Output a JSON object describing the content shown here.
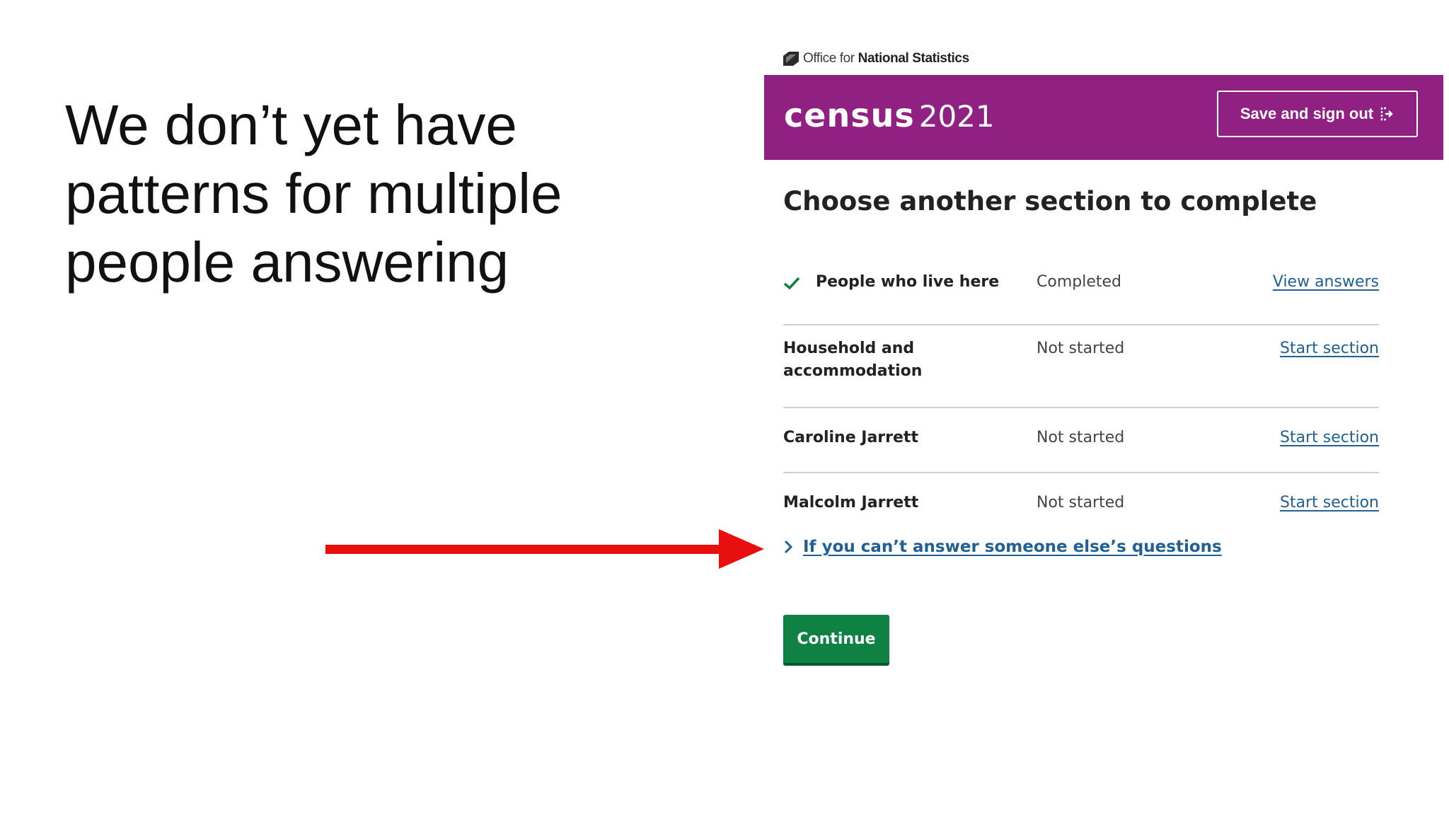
{
  "slide": {
    "lines": [
      "We don’t yet have",
      "patterns for multiple",
      "people answering"
    ]
  },
  "ons": {
    "org_prefix": "Office for",
    "org_name": "National Statistics"
  },
  "header": {
    "logo_word": "census",
    "logo_year": "2021",
    "signout_label": "Save and sign out"
  },
  "page": {
    "title": "Choose another section to complete"
  },
  "sections": [
    {
      "name": "People who live here",
      "status": "Completed",
      "action": "View answers",
      "completed": true
    },
    {
      "name": "Household and accommodation",
      "status": "Not started",
      "action": "Start section",
      "completed": false
    },
    {
      "name": "Caroline Jarrett",
      "status": "Not started",
      "action": "Start section",
      "completed": false
    },
    {
      "name": "Malcolm Jarrett",
      "status": "Not started",
      "action": "Start section",
      "completed": false
    }
  ],
  "details": {
    "label": "If you can’t answer someone else’s questions"
  },
  "actions": {
    "continue_label": "Continue"
  },
  "colors": {
    "header": "#902082",
    "link": "#206095",
    "continue": "#0f8243",
    "arrow": "#e8100e",
    "check": "#0f8243"
  }
}
